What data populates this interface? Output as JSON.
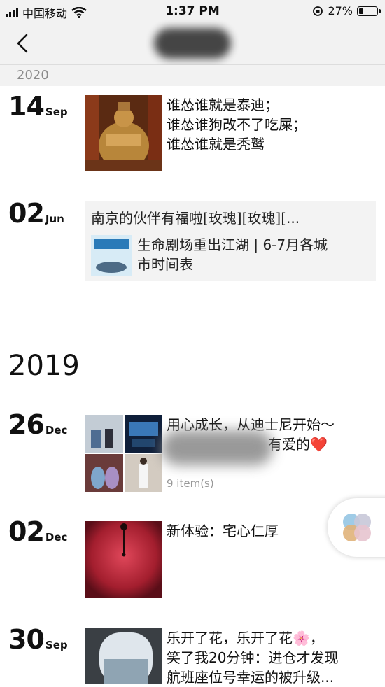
{
  "status_bar": {
    "carrier": "中国移动",
    "time": "1:37 PM",
    "battery_percent": "27%",
    "battery_level": 0.27
  },
  "nav": {
    "back_icon": "chevron-left-icon"
  },
  "sticky_year": "2020",
  "posts": [
    {
      "day": "14",
      "month": "Sep",
      "text_lines": [
        "谁怂谁就是泰迪；",
        "谁怂谁狗改不了吃屎；",
        "谁怂谁就是秃鹫"
      ]
    },
    {
      "day": "02",
      "month": "Jun",
      "share_title": "南京的伙伴有福啦[玫瑰][玫瑰][...",
      "share_lines": [
        "生命剧场重出江湖 | 6-7月各城",
        "市时间表"
      ]
    },
    {
      "day": "26",
      "month": "Dec",
      "text_lines": [
        "用心成长，从迪士尼开始～",
        "有爱的❤️"
      ],
      "item_count": "9 item(s)"
    },
    {
      "day": "02",
      "month": "Dec",
      "text_lines": [
        "新体验：宅心仁厚"
      ]
    },
    {
      "day": "30",
      "month": "Sep",
      "text_lines": [
        "乐开了花，乐开了花🌸，",
        "笑了我20分钟：进仓才发现",
        "航班座位号幸运的被升级..."
      ]
    }
  ],
  "year_heading": "2019",
  "colors": {
    "bar_bg": "#f2f2f2",
    "share_bg": "#f3f3f3",
    "muted_text": "#8a8a8a"
  }
}
